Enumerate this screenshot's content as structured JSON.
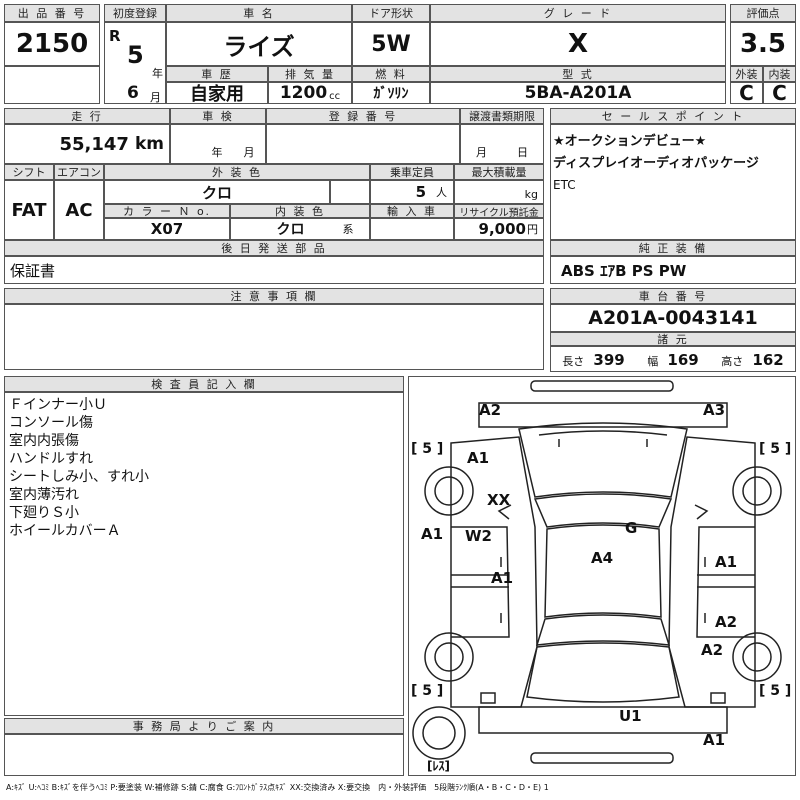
{
  "lot": {
    "header": "出 品 番 号",
    "value": "2150"
  },
  "reg": {
    "header": "初度登録",
    "era": "R",
    "year": "5",
    "year_unit": "年",
    "month": "6",
    "month_unit": "月"
  },
  "car_name": {
    "header": "車 名",
    "value": "ライズ"
  },
  "door": {
    "header": "ドア形状",
    "value": "5W"
  },
  "grade": {
    "header": "グ レ ー ド",
    "value": "X"
  },
  "score": {
    "header": "評価点",
    "value": "3.5"
  },
  "history": {
    "header": "車 歴",
    "value": "自家用"
  },
  "displacement": {
    "header": "排 気 量",
    "value": "1200",
    "unit": "cc"
  },
  "fuel": {
    "header": "燃 料",
    "value": "ｶﾞｿﾘﾝ"
  },
  "model_code": {
    "header": "型 式",
    "value": "5BA-A201A"
  },
  "ext_grade": {
    "header": "外装",
    "value": "C"
  },
  "int_grade": {
    "header": "内装",
    "value": "C"
  },
  "mileage": {
    "header": "走 行",
    "value": "55,147",
    "unit": "km"
  },
  "inspection": {
    "header": "車 検",
    "year_unit": "年",
    "month_unit": "月"
  },
  "plate": {
    "header": "登 録 番 号"
  },
  "transfer_limit": {
    "header": "譲渡書類期限",
    "month_unit": "月",
    "day_unit": "日"
  },
  "sales_point": {
    "header": "セ ー ル ス ポ イ ン ト",
    "lines": [
      "★オークションデビュー★",
      "ディスプレイオーディオパッケージ",
      "ETC"
    ]
  },
  "shift": {
    "header": "シフト",
    "value": "FAT"
  },
  "aircon": {
    "header": "エアコン",
    "value": "AC"
  },
  "ext_color": {
    "header": "外 装 色",
    "value": "クロ"
  },
  "capacity": {
    "header": "乗車定員",
    "value": "5",
    "unit": "人"
  },
  "max_load": {
    "header": "最大積載量",
    "unit": "kg"
  },
  "color_no": {
    "header": "カ ラ ー Ｎ o.",
    "value": "X07"
  },
  "int_color": {
    "header": "内 装 色",
    "value": "クロ",
    "unit": "系"
  },
  "import": {
    "header": "輸 入 車"
  },
  "recycle": {
    "header": "リサイクル預託金",
    "value": "9,000",
    "unit": "円"
  },
  "later_parts": {
    "header": "後 日 発 送 部 品",
    "value": "保証書"
  },
  "genuine": {
    "header": "純 正 装 備",
    "value": "ABS ｴｱB PS PW"
  },
  "notes": {
    "header": "注 意 事 項 欄"
  },
  "chassis": {
    "header": "車 台 番 号",
    "value": "A201A-0043141"
  },
  "dims": {
    "header": "諸 元",
    "length_label": "長さ",
    "length": "399",
    "width_label": "幅",
    "width": "169",
    "height_label": "高さ",
    "height": "162"
  },
  "inspector": {
    "header": "検 査 員 記 入 欄",
    "lines": [
      "Ｆインナー小Ｕ",
      "コンソール傷",
      "室内内張傷",
      "ハンドルすれ",
      "シートしみ小、すれ小",
      "室内薄汚れ",
      "下廻りＳ小",
      "ホイールカバーＡ"
    ]
  },
  "office": {
    "header": "事 務 局 よ り ご 案 内"
  },
  "diagram": {
    "tire_fl": "[ 5 ]",
    "tire_fr": "[ 5 ]",
    "tire_rl": "[ 5 ]",
    "tire_rr": "[ 5 ]",
    "spare": "[ﾚｽ]",
    "marks": [
      "A2",
      "A3",
      "A1",
      "XX",
      "A1",
      "W2",
      "A1",
      "G",
      "A4",
      "A1",
      "A2",
      "A2",
      "U1",
      "A1"
    ]
  },
  "legend": "A:ｷｽﾞ U:ﾍｺﾐ B:ｷｽﾞを伴うﾍｺﾐ P:要塗装 W:補修跡 S:錆 C:腐食 G:ﾌﾛﾝﾄｶﾞﾗｽ点ｷｽﾞ XX:交換済み X:要交換　内・外装評価　5段階ﾗﾝｸ順(A・B・C・D・E) 1"
}
